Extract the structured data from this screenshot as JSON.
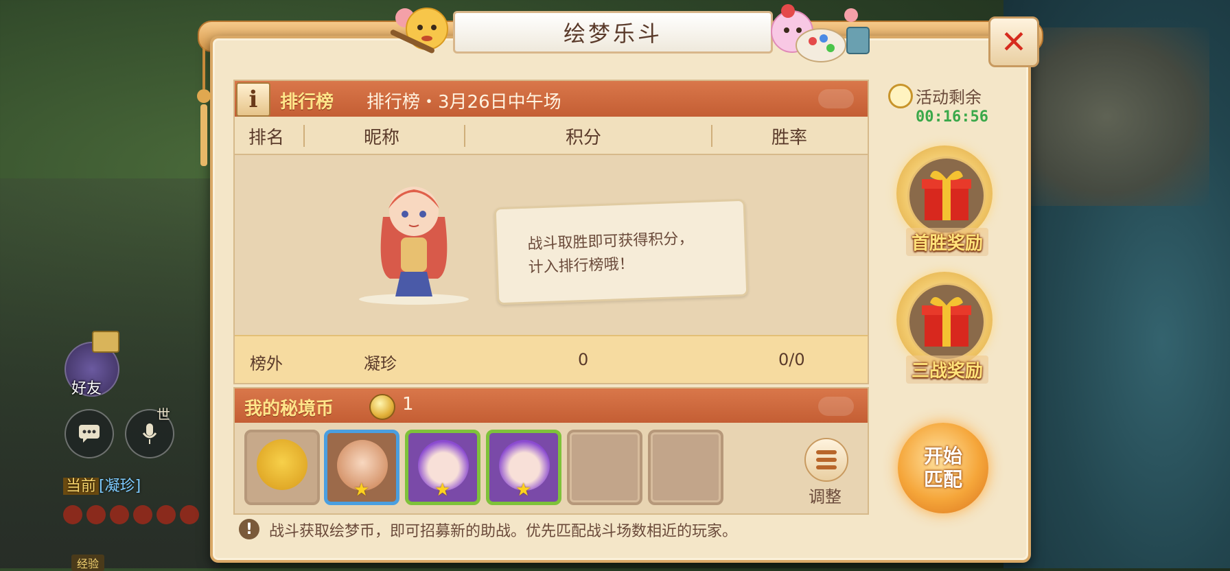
{
  "window": {
    "title": "绘梦乐斗"
  },
  "hud": {
    "friend_label": "好友",
    "world_label": "世",
    "chat": {
      "tag": "当前",
      "name": "[凝珍]"
    },
    "exp_label": "经验"
  },
  "ranking": {
    "tab_label": "排行榜",
    "subtitle": "排行榜・3月26日中午场",
    "columns": [
      "排名",
      "昵称",
      "积分",
      "胜率"
    ],
    "empty_hint": "战斗取胜即可获得积分，\n计入排行榜哦！",
    "my_row": {
      "rank": "榜外",
      "nickname": "凝珍",
      "score": "0",
      "win_rate": "0/0"
    }
  },
  "coins": {
    "title": "我的秘境币",
    "count": "1",
    "helpers": [
      {
        "slot": "gray",
        "stars": 0
      },
      {
        "slot": "blue",
        "stars": 1
      },
      {
        "slot": "green",
        "stars": 1
      },
      {
        "slot": "green",
        "stars": 1
      },
      {
        "slot": "empty",
        "stars": 0
      },
      {
        "slot": "empty",
        "stars": 0
      }
    ],
    "adjust_label": "调整"
  },
  "tip": "战斗获取绘梦币，即可招募新的助战。优先匹配战斗场数相近的玩家。",
  "side": {
    "timer_label": "活动剩余",
    "timer_value": "00:16:56",
    "first_win_label": "首胜奖励",
    "three_battle_label": "三战奖励",
    "match_label": "开始\n匹配"
  },
  "colors": {
    "accent": "#c45e34",
    "timer": "#3aa84a",
    "close": "#d62b1e"
  },
  "icons": [
    "info-icon",
    "close-icon",
    "coin-icon",
    "timer-icon",
    "gift-icon",
    "adjust-icon",
    "alert-icon"
  ]
}
